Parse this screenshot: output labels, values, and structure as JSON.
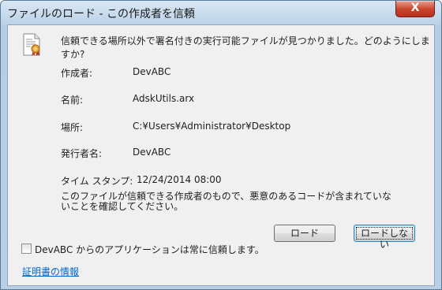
{
  "window": {
    "title": "ファイルのロード - この作成者を信頼",
    "close_symbol": "X"
  },
  "dialog": {
    "question": "信頼できる場所以外で署名付きの実行可能ファイルが見つかりました。どのようにしますか?",
    "fields": [
      {
        "label": "作成者:",
        "value": "DevABC"
      },
      {
        "label": "名前:",
        "value": "AdskUtils.arx"
      },
      {
        "label": "場所:",
        "value": "C:¥Users¥Administrator¥Desktop"
      },
      {
        "label": "発行者名:",
        "value": "DevABC"
      },
      {
        "label": "タイム スタンプ:",
        "value": "12/24/2014 08:00"
      }
    ],
    "message": "このファイルが信頼できる作成者のもので、悪意のあるコードが含まれていないことを確認してください。",
    "buttons": {
      "load": "ロード",
      "no_load": "ロードしない"
    },
    "trust_checkbox": {
      "label": "DevABC からのアプリケーションは常に信頼します。",
      "checked": false
    },
    "cert_link": "証明書の情報"
  }
}
